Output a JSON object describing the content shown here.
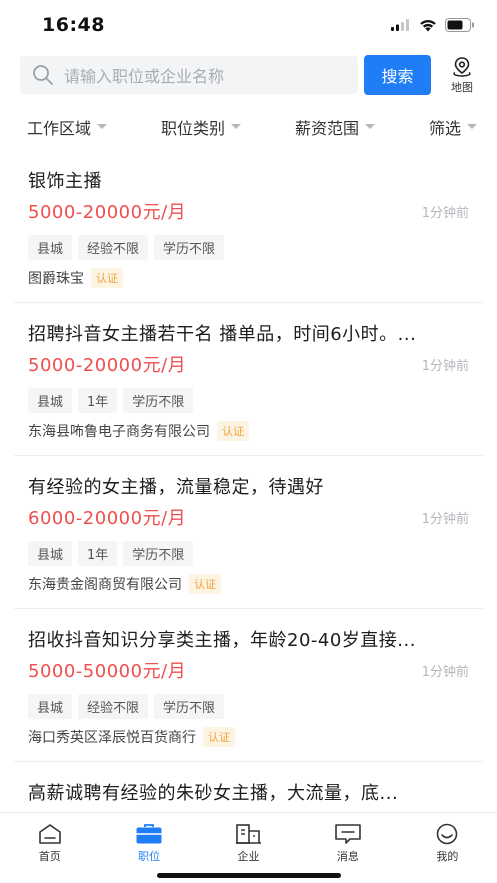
{
  "status_bar": {
    "time": "16:48"
  },
  "search": {
    "placeholder": "请输入职位或企业名称",
    "button_label": "搜索",
    "map_label": "地图"
  },
  "filters": [
    {
      "label": "工作区域"
    },
    {
      "label": "职位类别"
    },
    {
      "label": "薪资范围"
    },
    {
      "label": "筛选"
    }
  ],
  "jobs": [
    {
      "title": "银饰主播",
      "salary": "5000-20000元/月",
      "time": "1分钟前",
      "tags": [
        "县城",
        "经验不限",
        "学历不限"
      ],
      "company": "图爵珠宝",
      "verified": "认证"
    },
    {
      "title": "招聘抖音女主播若干名 播单品，时间6小时。...",
      "salary": "5000-20000元/月",
      "time": "1分钟前",
      "tags": [
        "县城",
        "1年",
        "学历不限"
      ],
      "company": "东海县咘鲁电子商务有限公司",
      "verified": "认证"
    },
    {
      "title": "有经验的女主播，流量稳定，待遇好",
      "salary": "6000-20000元/月",
      "time": "1分钟前",
      "tags": [
        "县城",
        "1年",
        "学历不限"
      ],
      "company": "东海贵金阁商贸有限公司",
      "verified": "认证"
    },
    {
      "title": "招收抖音知识分享类主播，年龄20-40岁直接...",
      "salary": "5000-50000元/月",
      "time": "1分钟前",
      "tags": [
        "县城",
        "经验不限",
        "学历不限"
      ],
      "company": "海口秀英区泽辰悦百货商行",
      "verified": "认证"
    },
    {
      "title": "高薪诚聘有经验的朱砂女主播，大流量，底...",
      "salary": "",
      "time": "",
      "tags": [],
      "company": "",
      "verified": ""
    }
  ],
  "tabs": [
    {
      "label": "首页",
      "icon": "home-icon",
      "active": false
    },
    {
      "label": "职位",
      "icon": "briefcase-icon",
      "active": true
    },
    {
      "label": "企业",
      "icon": "building-icon",
      "active": false
    },
    {
      "label": "消息",
      "icon": "message-icon",
      "active": false
    },
    {
      "label": "我的",
      "icon": "profile-icon",
      "active": false
    }
  ],
  "colors": {
    "accent": "#1f7ef6",
    "salary": "#ef4f4f",
    "verify": "#f2a335"
  }
}
